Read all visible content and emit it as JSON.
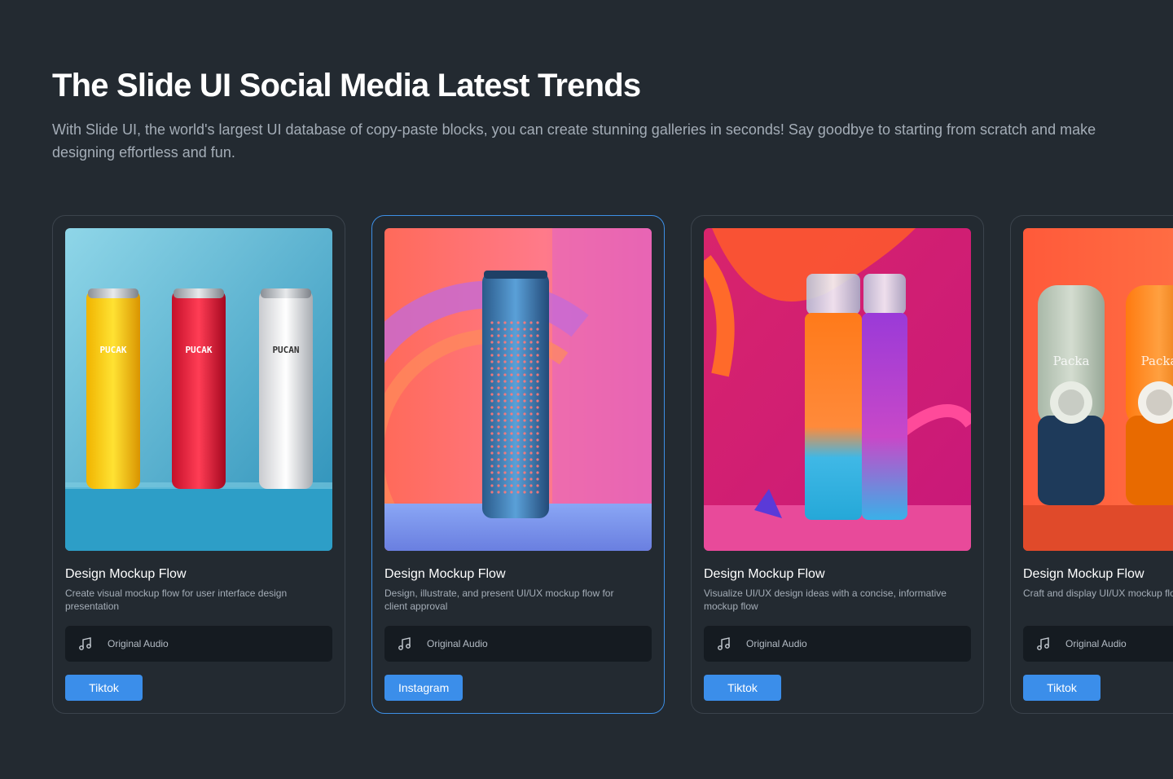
{
  "header": {
    "title": "The Slide UI Social Media Latest Trends",
    "subtitle": "With Slide UI, the world's largest UI database of copy-paste blocks, you can create stunning galleries in seconds! Say goodbye to starting from scratch and make designing effortless and fun."
  },
  "cards": [
    {
      "title": "Design Mockup Flow",
      "description": "Create visual mockup flow for user interface design presentation",
      "audio_label": "Original Audio",
      "audio_icon": "music-note-icon",
      "button_label": "Tiktok",
      "image_text": [
        "PUCAK",
        "PUCAK",
        "PUCAN"
      ]
    },
    {
      "title": "Design Mockup Flow",
      "description": "Design, illustrate, and present UI/UX mockup flow for client approval",
      "audio_label": "Original Audio",
      "audio_icon": "music-note-icon",
      "button_label": "Instagram"
    },
    {
      "title": "Design Mockup Flow",
      "description": "Visualize UI/UX design ideas with a concise, informative mockup flow",
      "audio_label": "Original Audio",
      "audio_icon": "music-note-icon",
      "button_label": "Tiktok"
    },
    {
      "title": "Design Mockup Flow",
      "description": "Craft and display UI/UX mockup flow for review",
      "audio_label": "Original Audio",
      "audio_icon": "music-note-icon",
      "button_label": "Tiktok",
      "image_text": [
        "Packa",
        "Packa"
      ]
    }
  ],
  "colors": {
    "background": "#232a31",
    "card_border": "#3b434c",
    "active_border": "#3d8fe6",
    "button": "#3b8eea",
    "audio_bar": "#151b21",
    "muted_text": "#a4adb7"
  }
}
